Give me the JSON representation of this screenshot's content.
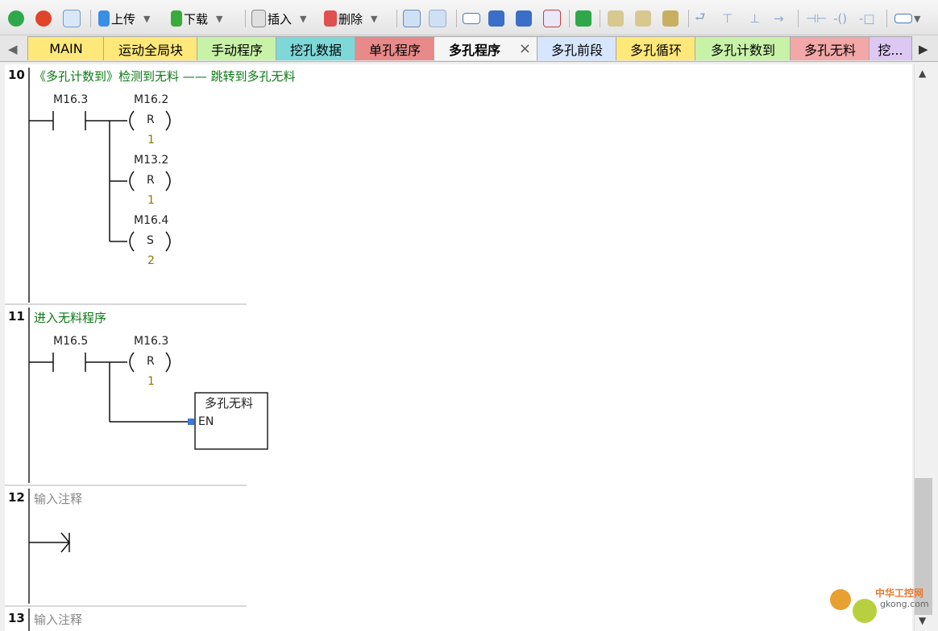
{
  "toolbar": {
    "upload_label": "上传",
    "download_label": "下载",
    "insert_label": "插入",
    "delete_label": "删除"
  },
  "tabs": [
    {
      "label": "MAIN",
      "color": "#ffe87a"
    },
    {
      "label": "运动全局块",
      "color": "#ffe87a"
    },
    {
      "label": "手动程序",
      "color": "#c8f2a8"
    },
    {
      "label": "挖孔数据",
      "color": "#7fd8d8"
    },
    {
      "label": "单孔程序",
      "color": "#e88a8a"
    },
    {
      "label": "多孔程序",
      "color": "#f5f5f5",
      "active": true
    },
    {
      "label": "多孔前段",
      "color": "#d6e6ff"
    },
    {
      "label": "多孔循环",
      "color": "#ffe87a"
    },
    {
      "label": "多孔计数到",
      "color": "#c8f2a8"
    },
    {
      "label": "多孔无料",
      "color": "#f2a8a8"
    },
    {
      "label": "挖...",
      "color": "#dcc8f2"
    }
  ],
  "networks": [
    {
      "number": "10",
      "comment": "《多孔计数到》检测到无料 —— 跳转到多孔无料",
      "contacts": [
        "M16.3"
      ],
      "coils": [
        {
          "address": "M16.2",
          "type": "R",
          "value": "1"
        },
        {
          "address": "M13.2",
          "type": "R",
          "value": "1"
        },
        {
          "address": "M16.4",
          "type": "S",
          "value": "2"
        }
      ]
    },
    {
      "number": "11",
      "comment": "进入无料程序",
      "contacts": [
        "M16.5"
      ],
      "coils": [
        {
          "address": "M16.3",
          "type": "R",
          "value": "1"
        }
      ],
      "block": {
        "title": "多孔无料",
        "pin": "EN"
      }
    },
    {
      "number": "12",
      "comment": "输入注释"
    },
    {
      "number": "13",
      "comment": "输入注释"
    }
  ],
  "watermark": {
    "text": "中华工控网",
    "site": "gkong.com"
  }
}
